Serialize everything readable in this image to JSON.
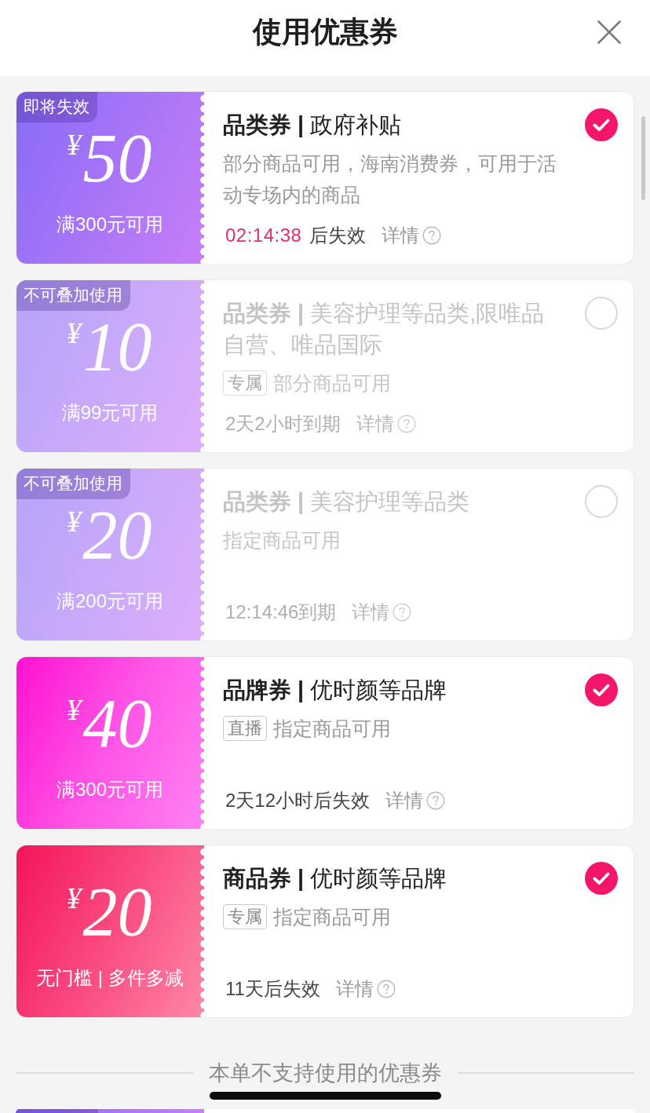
{
  "header": {
    "title": "使用优惠券"
  },
  "coupons": [
    {
      "kind": "category",
      "badge": "即将失效",
      "currency": "¥",
      "amount": "50",
      "condition": "满300元可用",
      "title": "**品类券 |** 政府补贴",
      "description": "部分商品可用，海南消费券，可用于活动专场内的商品",
      "countdown": "02:14:38",
      "expiry": "后失效",
      "details": "详情",
      "selected": true,
      "disabled": false
    },
    {
      "kind": "category",
      "badge": "不可叠加使用",
      "currency": "¥",
      "amount": "10",
      "condition": "满99元可用",
      "title": "**品类券 |** 美容护理等品类,限唯品自营、唯品国际",
      "tag": "专属",
      "description": "部分商品可用",
      "expiry": "2天2小时到期",
      "details": "详情",
      "selected": false,
      "disabled": true
    },
    {
      "kind": "category",
      "badge": "不可叠加使用",
      "currency": "¥",
      "amount": "20",
      "condition": "满200元可用",
      "title": "**品类券 |** 美容护理等品类",
      "description": "指定商品可用",
      "expiry": "12:14:46到期",
      "details": "详情",
      "selected": false,
      "disabled": true
    },
    {
      "kind": "brand",
      "currency": "¥",
      "amount": "40",
      "condition": "满300元可用",
      "title": "**品牌券 |** 优时颜等品牌",
      "tag": "直播",
      "description": "指定商品可用",
      "expiry": "2天12小时后失效",
      "details": "详情",
      "selected": true,
      "disabled": false
    },
    {
      "kind": "product",
      "currency": "¥",
      "amount": "20",
      "condition": "无门槛 | 多件多减",
      "title": "**商品券 |** 优时颜等品牌",
      "tag": "专属",
      "description": "指定商品可用",
      "expiry": "11天后失效",
      "details": "详情",
      "selected": true,
      "disabled": false
    }
  ],
  "unavailable_section": {
    "heading": "本单不支持使用的优惠券",
    "peek": {
      "kind": "category",
      "badge_shown": true
    }
  }
}
